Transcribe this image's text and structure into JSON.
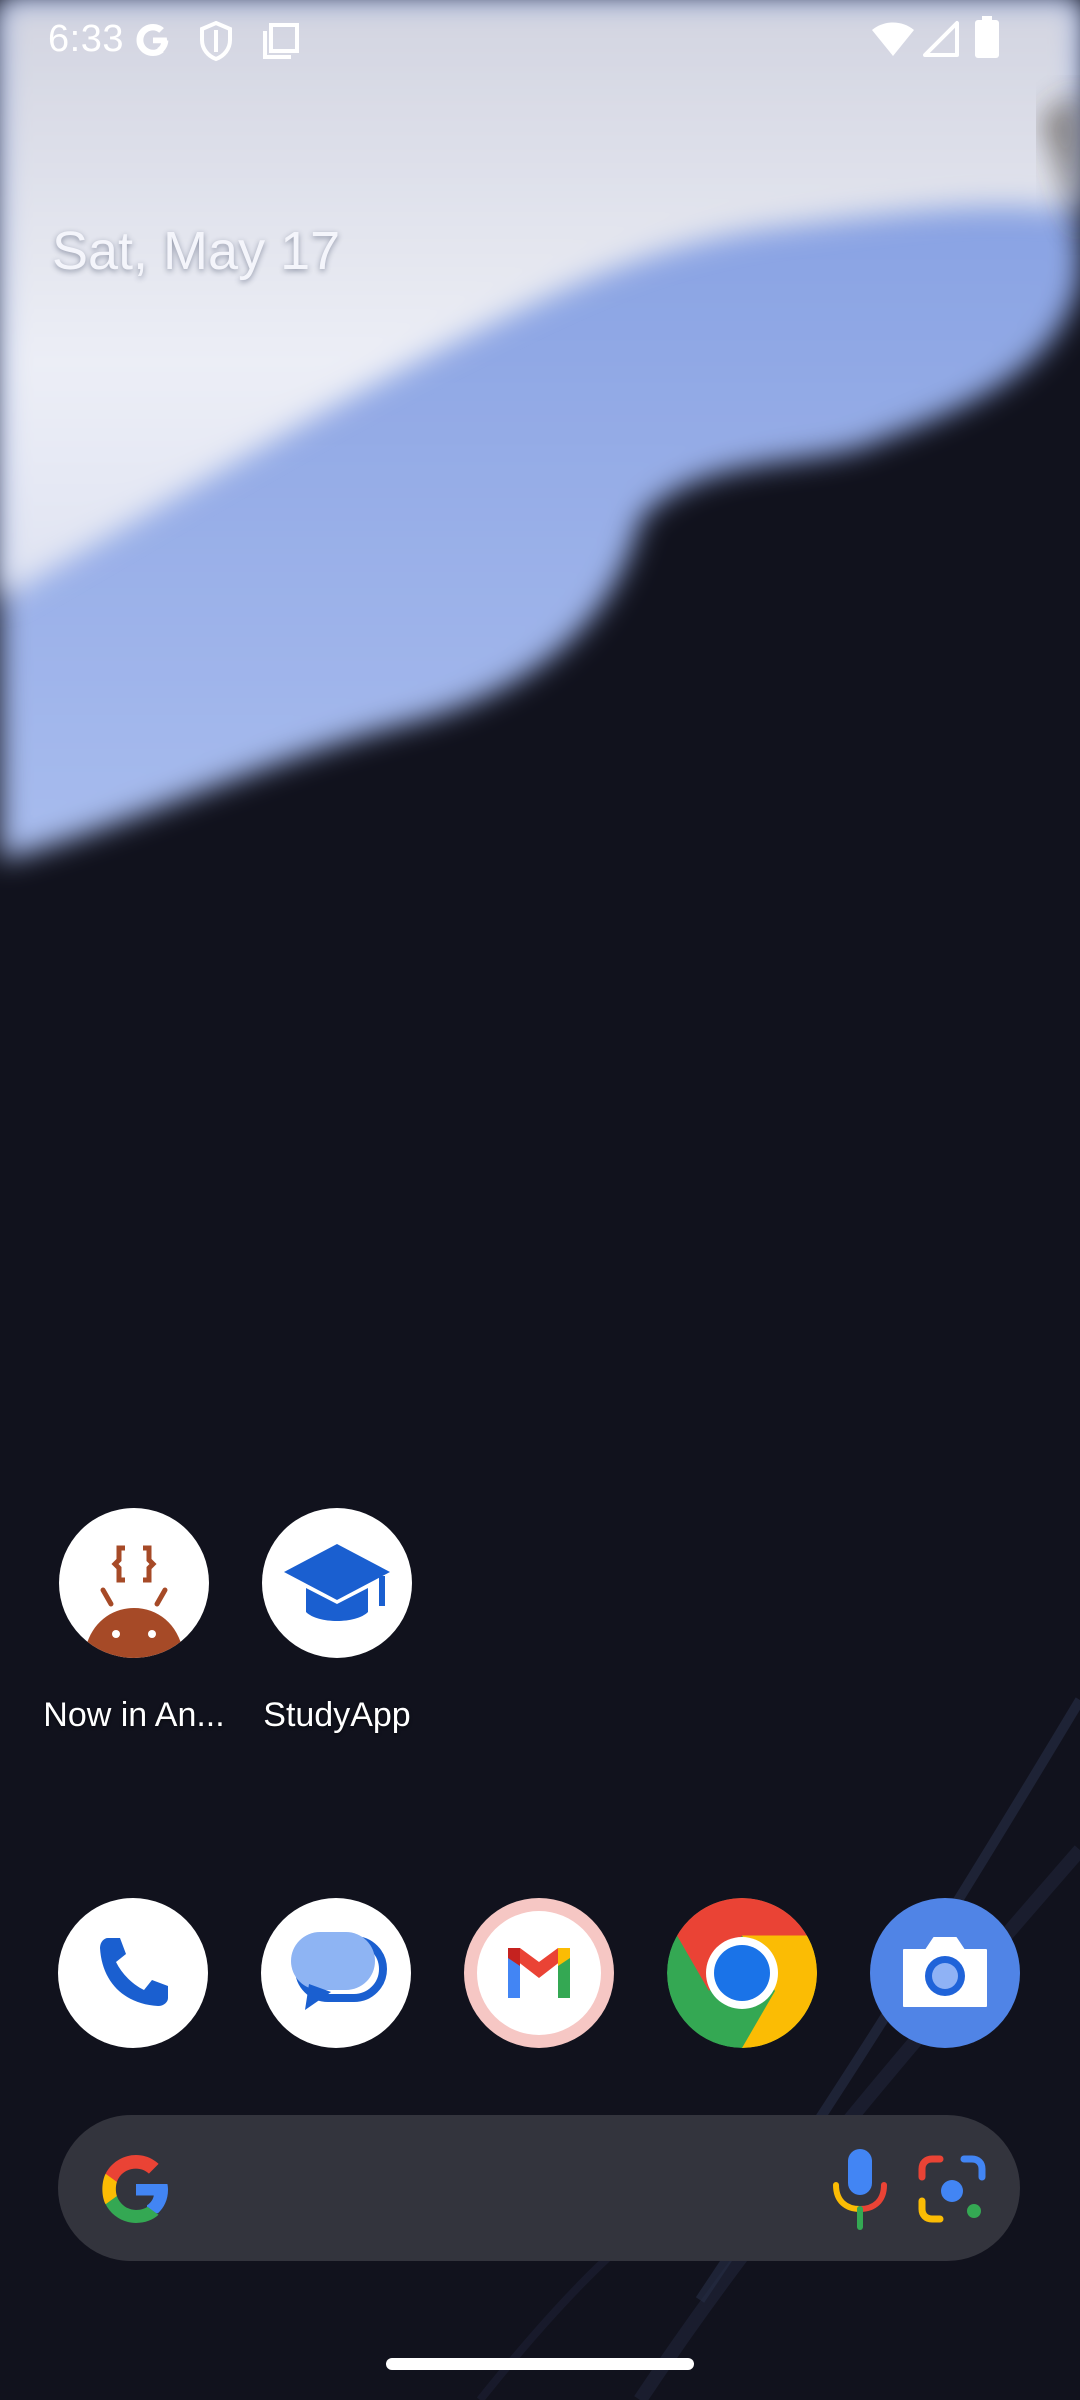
{
  "status_bar": {
    "time": "6:33",
    "icons": [
      "google-icon",
      "shield-icon",
      "screenshot-icon",
      "wifi-icon",
      "signal-icon",
      "battery-icon"
    ]
  },
  "date_widget": {
    "text": "Sat, May 17"
  },
  "home_apps": [
    {
      "label": "Now in An...",
      "icon": "now-in-android-icon"
    },
    {
      "label": "StudyApp",
      "icon": "graduation-cap-icon"
    }
  ],
  "dock": [
    {
      "icon": "phone-icon"
    },
    {
      "icon": "messages-icon"
    },
    {
      "icon": "gmail-icon"
    },
    {
      "icon": "chrome-icon"
    },
    {
      "icon": "camera-icon"
    }
  ],
  "search_bar": {
    "icons": [
      "google-g-icon",
      "mic-icon",
      "lens-icon"
    ]
  },
  "colors": {
    "background": "#11121d",
    "wallpaper_light": "#e3e5f0",
    "wallpaper_blue": "#8ea7e2",
    "search_bar": "#33343d",
    "google_blue": "#4285f4",
    "google_red": "#ea4335",
    "google_yellow": "#fbbc04",
    "google_green": "#34a853"
  }
}
